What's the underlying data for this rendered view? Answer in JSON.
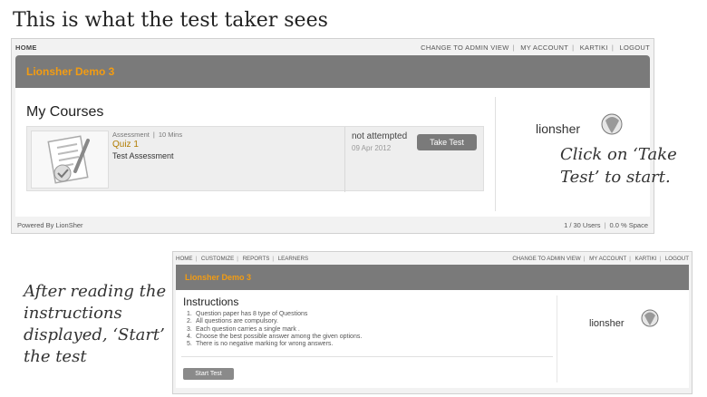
{
  "slide": {
    "title": "This is what the test taker sees",
    "note_take_test": "Click on ‘Take Test’ to start.",
    "note_start_test": "After reading the instructions displayed, ‘Start’ the test"
  },
  "shot1": {
    "nav_left": "HOME",
    "nav_right": [
      "CHANGE TO ADMIN VIEW",
      "MY ACCOUNT",
      "KARTIKI",
      "LOGOUT"
    ],
    "banner": "Lionsher Demo 3",
    "section_title": "My Courses",
    "course": {
      "type": "Assessment",
      "duration": "10 Mins",
      "name": "Quiz 1",
      "description": "Test Assessment",
      "status": "not attempted",
      "date": "09 Apr 2012",
      "action": "Take Test"
    },
    "logo_text": "lionsher",
    "footer_left": "Powered By LionSher",
    "footer_users": "1 / 30 Users",
    "footer_space": "0.0 % Space"
  },
  "shot2": {
    "nav_left": [
      "HOME",
      "CUSTOMIZE",
      "REPORTS",
      "LEARNERS"
    ],
    "nav_right": [
      "CHANGE TO ADMIN VIEW",
      "MY ACCOUNT",
      "KARTIKI",
      "LOGOUT"
    ],
    "banner": "Lionsher Demo 3",
    "section_title": "Instructions",
    "instructions": [
      "Question paper has 8 type of Questions",
      "All questions are compulsory.",
      "Each question carries a single mark .",
      "Choose the best possible answer among the given options.",
      "There is no negative marking for wrong answers."
    ],
    "action": "Start Test",
    "logo_text": "lionsher"
  },
  "colors": {
    "accent": "#f39c12",
    "banner": "#7a7a7a",
    "button": "#7a7a7a"
  }
}
